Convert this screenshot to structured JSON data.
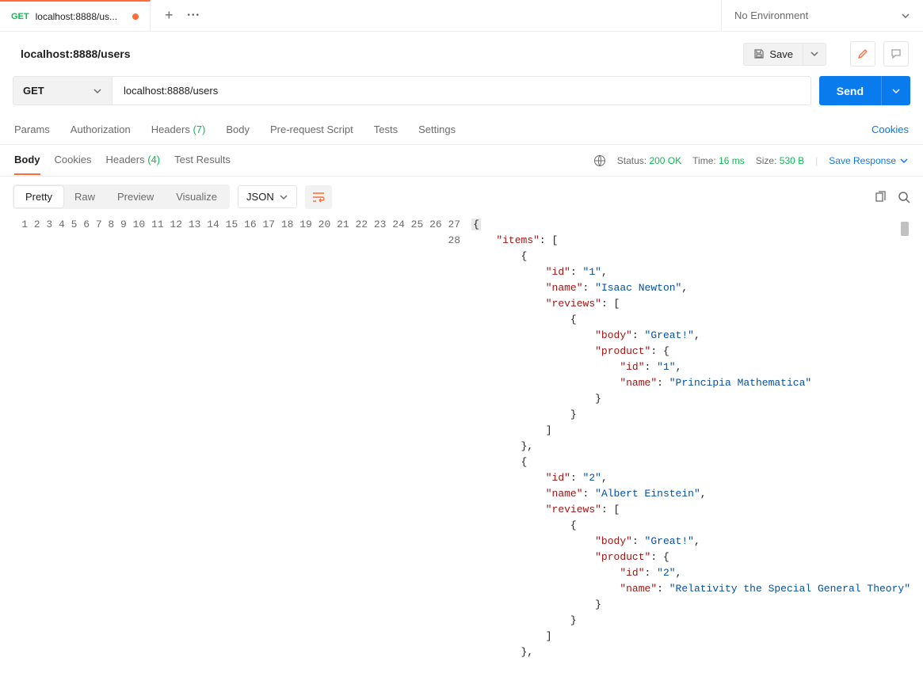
{
  "tabs": {
    "active": {
      "method": "GET",
      "title": "localhost:8888/us..."
    }
  },
  "env": {
    "label": "No Environment"
  },
  "request": {
    "title": "localhost:8888/users",
    "saveLabel": "Save",
    "method": "GET",
    "url": "localhost:8888/users",
    "sendLabel": "Send"
  },
  "reqTabs": {
    "params": "Params",
    "auth": "Authorization",
    "headers": "Headers",
    "headersCount": "(7)",
    "body": "Body",
    "preReq": "Pre-request Script",
    "tests": "Tests",
    "settings": "Settings",
    "cookies": "Cookies"
  },
  "respTabs": {
    "body": "Body",
    "cookies": "Cookies",
    "headers": "Headers",
    "headersCount": "(4)",
    "testResults": "Test Results"
  },
  "respMeta": {
    "statusLabel": "Status:",
    "statusValue": "200 OK",
    "timeLabel": "Time:",
    "timeValue": "16 ms",
    "sizeLabel": "Size:",
    "sizeValue": "530 B",
    "saveResp": "Save Response"
  },
  "viewModes": {
    "pretty": "Pretty",
    "raw": "Raw",
    "preview": "Preview",
    "visualize": "Visualize",
    "format": "JSON"
  },
  "responseBody": {
    "items": [
      {
        "id": "1",
        "name": "Isaac Newton",
        "reviews": [
          {
            "body": "Great!",
            "product": {
              "id": "1",
              "name": "Principia Mathematica"
            }
          }
        ]
      },
      {
        "id": "2",
        "name": "Albert Einstein",
        "reviews": [
          {
            "body": "Great!",
            "product": {
              "id": "2",
              "name": "Relativity the Special General Theory"
            }
          }
        ]
      }
    ]
  },
  "lineNumbers": [
    "1",
    "2",
    "3",
    "4",
    "5",
    "6",
    "7",
    "8",
    "9",
    "10",
    "11",
    "12",
    "13",
    "14",
    "15",
    "16",
    "17",
    "18",
    "19",
    "20",
    "21",
    "22",
    "23",
    "24",
    "25",
    "26",
    "27",
    "28"
  ]
}
